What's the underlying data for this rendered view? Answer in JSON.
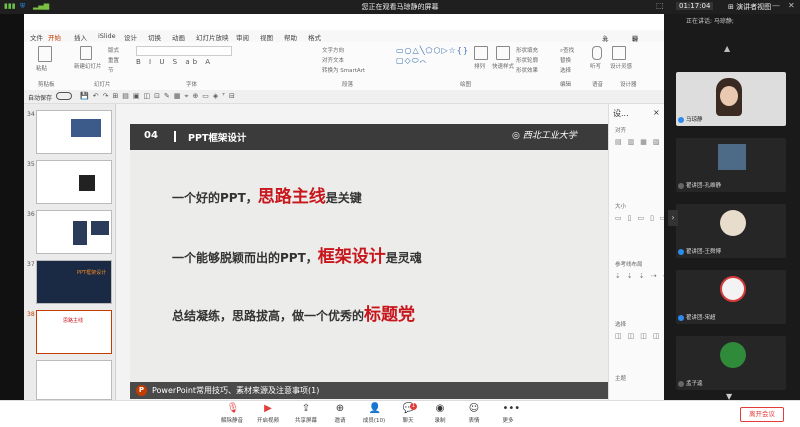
{
  "window": {
    "title": "您正在观看马琼静的屏幕",
    "clock": "01:17:04",
    "gallery_view": "演讲者视图"
  },
  "ppt": {
    "tabs": [
      "文件",
      "开始",
      "插入",
      "iSlide",
      "设计",
      "切换",
      "动画",
      "幻灯片放映",
      "审阅",
      "视图",
      "帮助",
      "格式"
    ],
    "active_tab": "开始",
    "share": "共享",
    "comment": "批注",
    "ribbon_groups": {
      "clipboard": "剪贴板",
      "slides": "幻灯片",
      "font": "字体",
      "paragraph": "段落",
      "drawing": "绘图",
      "editing": "编辑",
      "voice": "语音",
      "designer": "设计器"
    },
    "ribbon_buttons": {
      "paste": "粘贴",
      "new_slide": "新建幻灯片",
      "layout": "版式",
      "reset": "重置",
      "section": "节",
      "find": "查找",
      "replace": "替换",
      "select": "选择",
      "dictate": "听写",
      "design_ideas": "设计灵感",
      "text_direction": "文字方向",
      "align_text": "对齐文本",
      "smartart": "转换为 SmartArt",
      "arrange": "排列",
      "quick_styles": "快速样式",
      "shape_fill": "形状填充",
      "shape_outline": "形状轮廓",
      "shape_effects": "形状效果"
    },
    "format_painter": "自动保存",
    "slides": [
      {
        "num": "34"
      },
      {
        "num": "35"
      },
      {
        "num": "36"
      },
      {
        "num": "37"
      },
      {
        "num": "38"
      },
      {
        "num": ""
      }
    ],
    "thumb37_text": "PPT框架设计",
    "thumb38_text": "思路主线"
  },
  "slide": {
    "section_num": "04",
    "section_title": "PPT框架设计",
    "logo_text": "西北工业大学",
    "lines": [
      {
        "pre": "一个好的PPT，",
        "hl": "思路主线",
        "post": "是关键"
      },
      {
        "pre": "一个能够脱颖而出的PPT，",
        "hl": "框架设计",
        "post": "是灵魂"
      },
      {
        "pre": "总结凝练，思路拔高，做一个优秀的",
        "hl": "标题党",
        "post": ""
      }
    ],
    "footer": "PowerPoint常用技巧、素材来源及注意事项(1)",
    "footer_icon": "P"
  },
  "right_pane": {
    "title": "设...",
    "sections": [
      "对齐",
      "大小",
      "参考线布局",
      "选择",
      "主题"
    ]
  },
  "participants": {
    "speaker_label": "正在讲话: 马琼静;",
    "tiles": [
      {
        "name": "马琼静"
      },
      {
        "name": "翟讲团-孔维静"
      },
      {
        "name": "翟讲团-王舜博"
      },
      {
        "name": "翟讲团-宋超"
      },
      {
        "name": "孟子逵"
      }
    ]
  },
  "toolbar": {
    "buttons": [
      {
        "label": "解除静音"
      },
      {
        "label": "开启视频"
      },
      {
        "label": "共享屏幕"
      },
      {
        "label": "邀请"
      },
      {
        "label": "成员(10)"
      },
      {
        "label": "聊天"
      },
      {
        "label": "录制"
      },
      {
        "label": "表情"
      },
      {
        "label": "更多"
      }
    ],
    "chat_badge": "1",
    "leave": "离开会议"
  },
  "colors": {
    "accent": "#c43c00",
    "highlight": "#c8161d",
    "leave": "#e23c3c"
  }
}
